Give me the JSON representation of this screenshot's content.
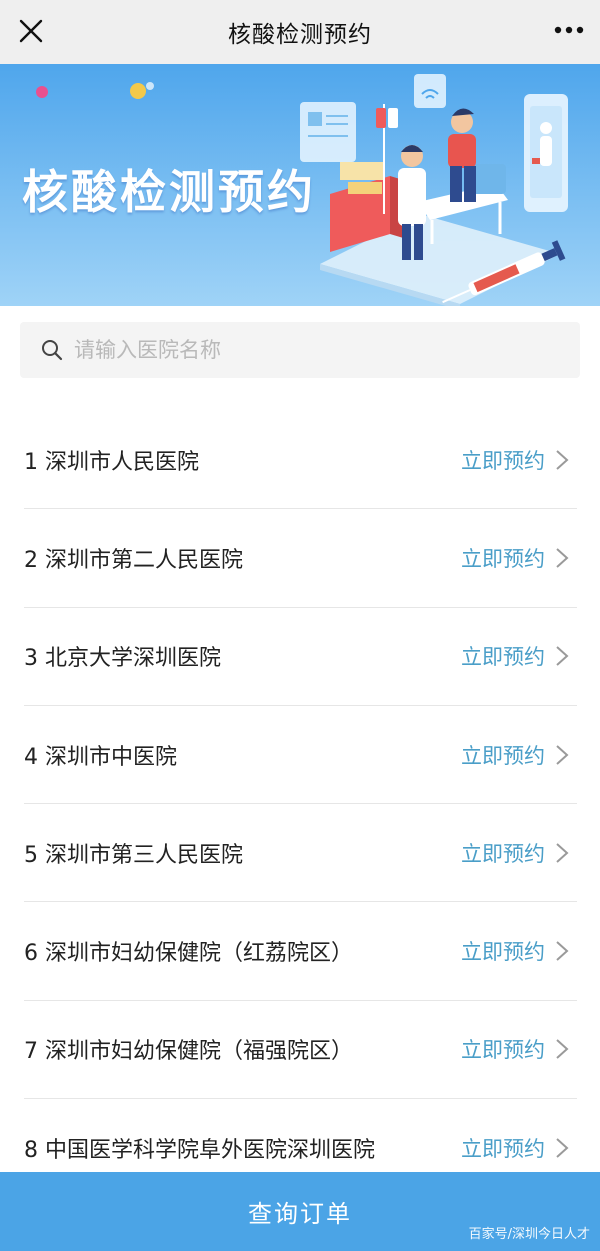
{
  "navbar": {
    "title": "核酸检测预约",
    "close_icon": "close-icon",
    "more_icon": "more-dots-icon"
  },
  "banner": {
    "title": "核酸检测预约",
    "colors": {
      "top": "#4fa6ec",
      "bottom": "#9fd3f7"
    }
  },
  "search": {
    "placeholder": "请输入医院名称",
    "value": "",
    "icon": "search-icon"
  },
  "hospitals": [
    {
      "name": "1 深圳市人民医院",
      "action": "立即预约"
    },
    {
      "name": "2 深圳市第二人民医院",
      "action": "立即预约"
    },
    {
      "name": "3 北京大学深圳医院",
      "action": "立即预约"
    },
    {
      "name": "4 深圳市中医院",
      "action": "立即预约"
    },
    {
      "name": "5 深圳市第三人民医院",
      "action": "立即预约"
    },
    {
      "name": "6 深圳市妇幼保健院（红荔院区）",
      "action": "立即预约"
    },
    {
      "name": "7 深圳市妇幼保健院（福强院区）",
      "action": "立即预约"
    },
    {
      "name": "8 中国医学科学院阜外医院深圳医院",
      "action": "立即预约"
    }
  ],
  "bottom": {
    "label": "查询订单",
    "watermark": "百家号/深圳今日人才"
  },
  "colors": {
    "accent": "#4a9ec8",
    "button": "#4ba4e6",
    "navbar": "#efefef"
  }
}
